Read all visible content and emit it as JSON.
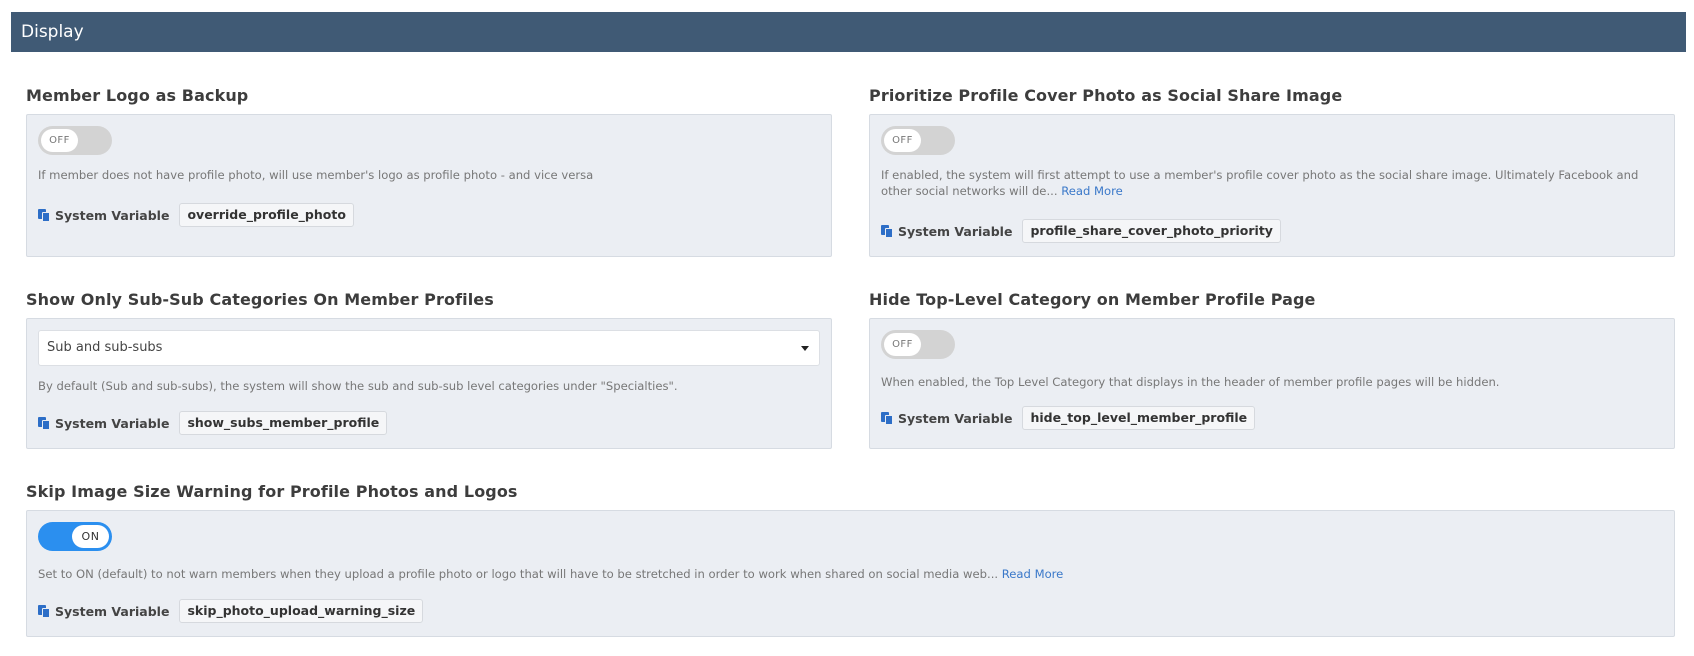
{
  "header": {
    "title": "Display"
  },
  "settings": {
    "member_logo": {
      "title": "Member Logo as Backup",
      "toggle": "OFF",
      "description": "If member does not have profile photo, will use member's logo as profile photo - and vice versa",
      "sysvar_label": "System Variable",
      "sysvar_value": "override_profile_photo"
    },
    "cover_photo": {
      "title": "Prioritize Profile Cover Photo as Social Share Image",
      "toggle": "OFF",
      "description": "If enabled, the system will first attempt to use a member's profile cover photo as the social share image. Ultimately Facebook and other social networks will de...",
      "read_more": "Read More",
      "sysvar_label": "System Variable",
      "sysvar_value": "profile_share_cover_photo_priority"
    },
    "sub_categories": {
      "title": "Show Only Sub-Sub Categories On Member Profiles",
      "select_value": "Sub and sub-subs",
      "description": "By default (Sub and sub-subs), the system will show the sub and sub-sub level categories under \"Specialties\".",
      "sysvar_label": "System Variable",
      "sysvar_value": "show_subs_member_profile"
    },
    "hide_top_level": {
      "title": "Hide Top-Level Category on Member Profile Page",
      "toggle": "OFF",
      "description": "When enabled, the Top Level Category that displays in the header of member profile pages will be hidden.",
      "sysvar_label": "System Variable",
      "sysvar_value": "hide_top_level_member_profile"
    },
    "skip_warning": {
      "title": "Skip Image Size Warning for Profile Photos and Logos",
      "toggle": "ON",
      "description": "Set to ON (default) to not warn members when they upload a profile photo or logo that will have to be stretched in order to work when shared on social media web...",
      "read_more": "Read More",
      "sysvar_label": "System Variable",
      "sysvar_value": "skip_photo_upload_warning_size"
    }
  },
  "colors": {
    "header_bg": "#405a75",
    "toggle_on": "#2b8fef",
    "link": "#3a78c9",
    "panel_bg": "#ebeef3"
  }
}
